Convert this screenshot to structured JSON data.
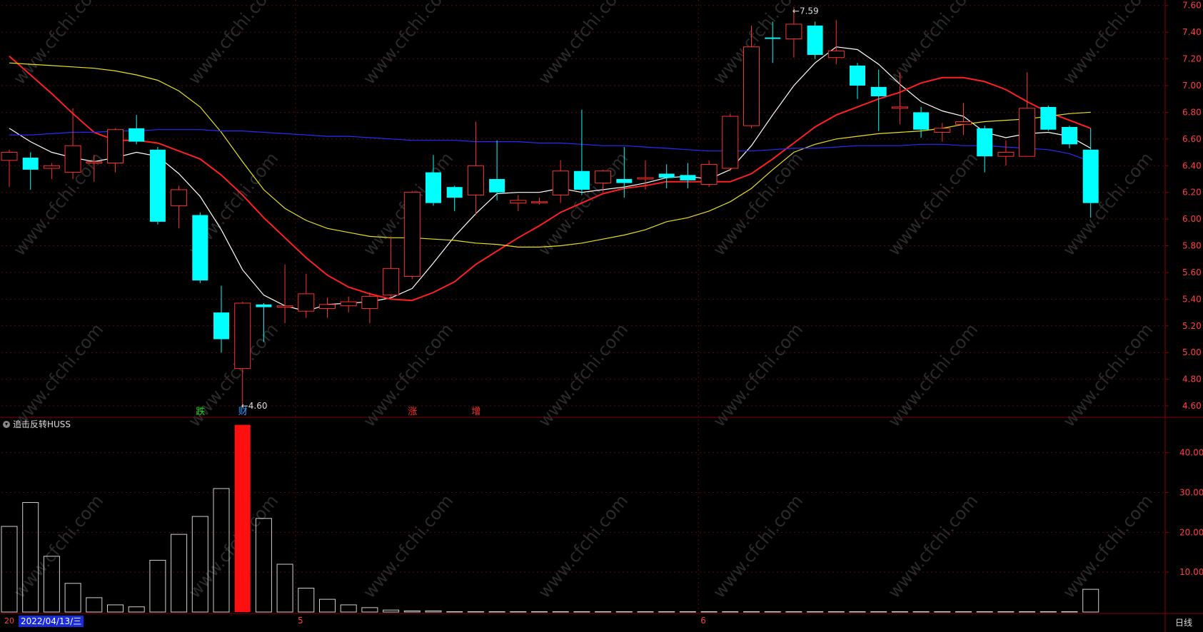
{
  "chart_data": {
    "type": "candlestick",
    "price_axis": {
      "ticks": [
        7.6,
        7.4,
        7.2,
        7.0,
        6.8,
        6.6,
        6.4,
        6.2,
        6.0,
        5.8,
        5.6,
        5.4,
        5.2,
        5.0,
        4.8,
        4.6
      ],
      "range": [
        4.52,
        7.62
      ]
    },
    "candles": [
      {
        "o": 6.44,
        "c": 6.5,
        "h": 6.52,
        "l": 6.24
      },
      {
        "o": 6.46,
        "c": 6.37,
        "h": 6.5,
        "l": 6.22
      },
      {
        "o": 6.38,
        "c": 6.4,
        "h": 6.42,
        "l": 6.3
      },
      {
        "o": 6.35,
        "c": 6.55,
        "h": 6.83,
        "l": 6.3
      },
      {
        "o": 6.42,
        "c": 6.43,
        "h": 6.48,
        "l": 6.28
      },
      {
        "o": 6.42,
        "c": 6.67,
        "h": 6.68,
        "l": 6.35
      },
      {
        "o": 6.68,
        "c": 6.58,
        "h": 6.78,
        "l": 6.56
      },
      {
        "o": 6.52,
        "c": 5.98,
        "h": 6.54,
        "l": 5.96
      },
      {
        "o": 6.1,
        "c": 6.22,
        "h": 6.25,
        "l": 5.93
      },
      {
        "o": 6.03,
        "c": 5.54,
        "h": 6.05,
        "l": 5.52
      },
      {
        "o": 5.3,
        "c": 5.1,
        "h": 5.5,
        "l": 5.0
      },
      {
        "o": 4.88,
        "c": 5.37,
        "h": 5.38,
        "l": 4.6
      },
      {
        "o": 5.36,
        "c": 5.34,
        "h": 5.37,
        "l": 5.08
      },
      {
        "o": 5.34,
        "c": 5.35,
        "h": 5.66,
        "l": 5.22
      },
      {
        "o": 5.31,
        "c": 5.44,
        "h": 5.59,
        "l": 5.26
      },
      {
        "o": 5.33,
        "c": 5.36,
        "h": 5.41,
        "l": 5.26
      },
      {
        "o": 5.35,
        "c": 5.38,
        "h": 5.42,
        "l": 5.3
      },
      {
        "o": 5.33,
        "c": 5.42,
        "h": 5.45,
        "l": 5.22
      },
      {
        "o": 5.43,
        "c": 5.63,
        "h": 5.87,
        "l": 5.41
      },
      {
        "o": 5.57,
        "c": 6.2,
        "h": 6.21,
        "l": 5.55
      },
      {
        "o": 6.35,
        "c": 6.12,
        "h": 6.48,
        "l": 6.1
      },
      {
        "o": 6.24,
        "c": 6.16,
        "h": 6.25,
        "l": 6.06
      },
      {
        "o": 6.18,
        "c": 6.4,
        "h": 6.73,
        "l": 6.03
      },
      {
        "o": 6.3,
        "c": 6.2,
        "h": 6.59,
        "l": 6.14
      },
      {
        "o": 6.12,
        "c": 6.14,
        "h": 6.18,
        "l": 6.06
      },
      {
        "o": 6.13,
        "c": 6.13,
        "h": 6.16,
        "l": 6.11
      },
      {
        "o": 6.18,
        "c": 6.36,
        "h": 6.44,
        "l": 6.12
      },
      {
        "o": 6.36,
        "c": 6.22,
        "h": 6.82,
        "l": 6.18
      },
      {
        "o": 6.27,
        "c": 6.36,
        "h": 6.37,
        "l": 6.2
      },
      {
        "o": 6.3,
        "c": 6.27,
        "h": 6.54,
        "l": 6.16
      },
      {
        "o": 6.3,
        "c": 6.31,
        "h": 6.44,
        "l": 6.22
      },
      {
        "o": 6.34,
        "c": 6.31,
        "h": 6.41,
        "l": 6.23
      },
      {
        "o": 6.33,
        "c": 6.29,
        "h": 6.42,
        "l": 6.23
      },
      {
        "o": 6.26,
        "c": 6.41,
        "h": 6.44,
        "l": 6.24
      },
      {
        "o": 6.38,
        "c": 6.77,
        "h": 6.79,
        "l": 6.36
      },
      {
        "o": 6.7,
        "c": 7.29,
        "h": 7.45,
        "l": 6.68
      },
      {
        "o": 7.36,
        "c": 7.35,
        "h": 7.48,
        "l": 7.17
      },
      {
        "o": 7.35,
        "c": 7.46,
        "h": 7.59,
        "l": 7.21
      },
      {
        "o": 7.45,
        "c": 7.23,
        "h": 7.48,
        "l": 7.2
      },
      {
        "o": 7.21,
        "c": 7.26,
        "h": 7.49,
        "l": 7.16
      },
      {
        "o": 7.15,
        "c": 7.0,
        "h": 7.17,
        "l": 6.9
      },
      {
        "o": 6.99,
        "c": 6.92,
        "h": 7.12,
        "l": 6.66
      },
      {
        "o": 6.83,
        "c": 6.84,
        "h": 7.1,
        "l": 6.71
      },
      {
        "o": 6.8,
        "c": 6.67,
        "h": 6.84,
        "l": 6.61
      },
      {
        "o": 6.65,
        "c": 6.68,
        "h": 6.72,
        "l": 6.58
      },
      {
        "o": 6.71,
        "c": 6.73,
        "h": 6.87,
        "l": 6.63
      },
      {
        "o": 6.68,
        "c": 6.47,
        "h": 6.7,
        "l": 6.35
      },
      {
        "o": 6.47,
        "c": 6.5,
        "h": 6.59,
        "l": 6.4
      },
      {
        "o": 6.47,
        "c": 6.83,
        "h": 7.1,
        "l": 6.47
      },
      {
        "o": 6.84,
        "c": 6.67,
        "h": 6.85,
        "l": 6.66
      },
      {
        "o": 6.69,
        "c": 6.56,
        "h": 6.7,
        "l": 6.53
      },
      {
        "o": 6.52,
        "c": 6.12,
        "h": 6.68,
        "l": 6.01
      }
    ],
    "ma_lines": [
      {
        "color": "#ffffff",
        "values": [
          6.68,
          6.58,
          6.5,
          6.46,
          6.43,
          6.46,
          6.5,
          6.47,
          6.34,
          6.17,
          5.92,
          5.62,
          5.43,
          5.35,
          5.31,
          5.36,
          5.37,
          5.38,
          5.41,
          5.48,
          5.67,
          5.87,
          6.04,
          6.19,
          6.2,
          6.2,
          6.23,
          6.2,
          6.22,
          6.24,
          6.27,
          6.31,
          6.32,
          6.3,
          6.37,
          6.55,
          6.78,
          7.0,
          7.17,
          7.29,
          7.27,
          7.16,
          7.01,
          6.88,
          6.81,
          6.77,
          6.65,
          6.61,
          6.64,
          6.65,
          6.62,
          6.53
        ]
      },
      {
        "color": "#ff2020",
        "values": [
          7.22,
          7.08,
          6.94,
          6.79,
          6.65,
          6.59,
          6.59,
          6.57,
          6.51,
          6.45,
          6.33,
          6.18,
          6.01,
          5.86,
          5.71,
          5.58,
          5.49,
          5.44,
          5.4,
          5.39,
          5.45,
          5.53,
          5.66,
          5.76,
          5.86,
          5.95,
          6.05,
          6.12,
          6.19,
          6.23,
          6.25,
          6.28,
          6.28,
          6.28,
          6.28,
          6.34,
          6.45,
          6.57,
          6.69,
          6.78,
          6.84,
          6.9,
          6.95,
          7.02,
          7.06,
          7.06,
          7.03,
          6.97,
          6.88,
          6.8,
          6.74,
          6.68
        ]
      },
      {
        "color": "#e8e020",
        "values": [
          7.17,
          7.16,
          7.15,
          7.14,
          7.13,
          7.11,
          7.08,
          7.04,
          6.96,
          6.84,
          6.65,
          6.43,
          6.22,
          6.08,
          5.99,
          5.93,
          5.9,
          5.87,
          5.86,
          5.86,
          5.85,
          5.84,
          5.82,
          5.81,
          5.79,
          5.79,
          5.8,
          5.82,
          5.85,
          5.88,
          5.92,
          5.98,
          6.01,
          6.06,
          6.13,
          6.23,
          6.37,
          6.5,
          6.56,
          6.6,
          6.62,
          6.64,
          6.65,
          6.66,
          6.68,
          6.71,
          6.73,
          6.74,
          6.75,
          6.77,
          6.79,
          6.8
        ]
      },
      {
        "color": "#2a2aff",
        "values": [
          6.63,
          6.63,
          6.64,
          6.65,
          6.65,
          6.66,
          6.66,
          6.67,
          6.67,
          6.67,
          6.66,
          6.66,
          6.65,
          6.64,
          6.63,
          6.62,
          6.62,
          6.61,
          6.6,
          6.59,
          6.59,
          6.59,
          6.58,
          6.58,
          6.58,
          6.57,
          6.57,
          6.56,
          6.55,
          6.55,
          6.54,
          6.53,
          6.52,
          6.51,
          6.51,
          6.51,
          6.52,
          6.53,
          6.53,
          6.54,
          6.55,
          6.55,
          6.55,
          6.56,
          6.56,
          6.55,
          6.55,
          6.54,
          6.53,
          6.52,
          6.49,
          6.43
        ]
      }
    ],
    "high_label": "7.59",
    "low_label": "4.60",
    "signal_markers": [
      {
        "index": 9,
        "text": "跌",
        "color": "#20d020"
      },
      {
        "index": 11,
        "text": "财",
        "color": "#30a0ff"
      },
      {
        "index": 19,
        "text": "涨",
        "color": "#ff3030"
      },
      {
        "index": 22,
        "text": "增",
        "color": "#ff3030"
      }
    ],
    "indicator": {
      "title": "追击反转HUSS",
      "axis_ticks": [
        40.0,
        30.0,
        20.0,
        10.0
      ],
      "axis_labels": [
        "40.00",
        "30.00",
        "20.00",
        "10.00"
      ],
      "range": [
        0,
        48
      ],
      "values": [
        21.5,
        27.5,
        14,
        7.2,
        3.6,
        1.8,
        1.3,
        13,
        19.5,
        24,
        31,
        47,
        23.5,
        12,
        6,
        3.2,
        1.8,
        1.1,
        0.5,
        0.3,
        0.3,
        0.1,
        0.1,
        0.1,
        0.1,
        0.1,
        0.1,
        0.1,
        0.1,
        0.1,
        0.1,
        0.1,
        0.1,
        0.1,
        0.1,
        0.1,
        0.1,
        0.1,
        0.1,
        0.1,
        0.1,
        0.1,
        0.1,
        0.1,
        0.1,
        0.1,
        0.1,
        0.1,
        0.1,
        0.1,
        0.1,
        5.7
      ],
      "highlight_index": 11
    },
    "x_labels": [
      {
        "index": 14,
        "text": "5"
      },
      {
        "index": 33,
        "text": "6"
      }
    ],
    "price_tick_labels": [
      "7.60",
      "7.40",
      "7.20",
      "7.00",
      "6.80",
      "6.60",
      "6.40",
      "6.20",
      "6.00",
      "5.80",
      "5.60",
      "5.40",
      "5.20",
      "5.00",
      "4.80",
      "4.60"
    ]
  },
  "footer": {
    "date_prefix": "20",
    "selected_date": "2022/04/13/三",
    "period": "日线"
  },
  "watermark": "www.cfchi.com",
  "colors": {
    "up": "#ff3030",
    "down": "#00ffff",
    "frame": "#8b0000",
    "axis_text": "#ff4040"
  }
}
